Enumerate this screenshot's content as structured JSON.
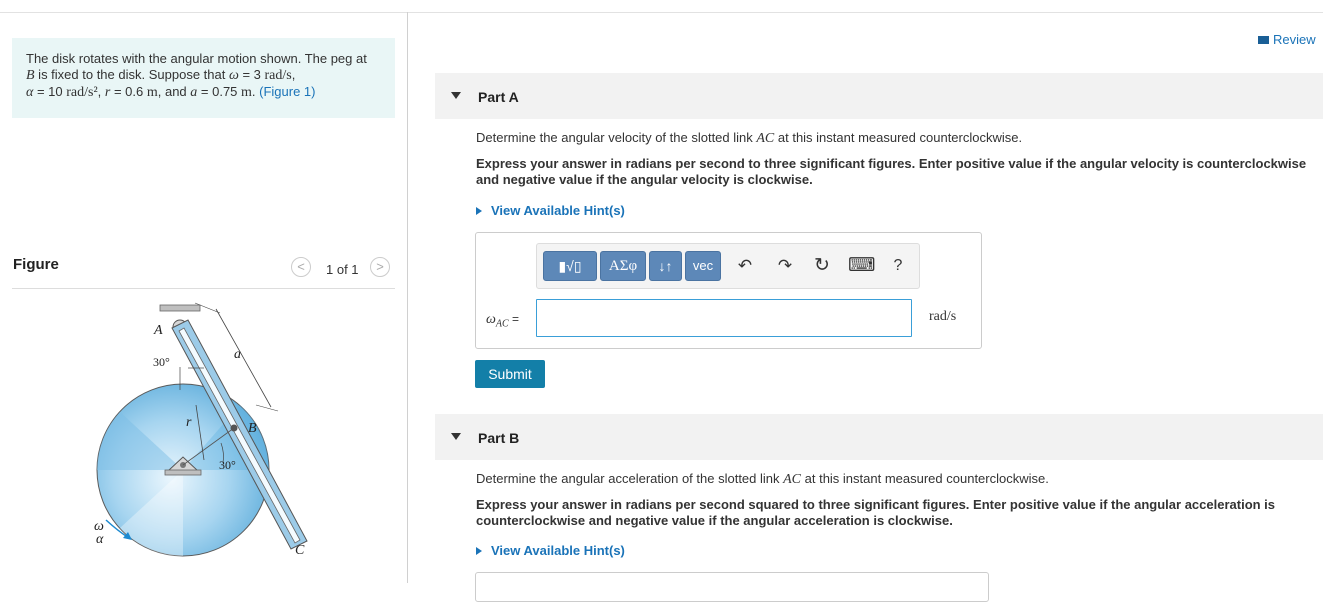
{
  "problem": {
    "line1": "The disk rotates with the angular motion shown. The peg at",
    "line2_var": "B",
    "line2_text": " is fixed to the disk. Suppose that ",
    "omega_sym": "ω",
    "omega_eq": " = 3 ",
    "omega_unit": "rad/s",
    "line2_end": ",",
    "alpha_sym": "α",
    "alpha_eq": " = 10 ",
    "alpha_unit": "rad/s²",
    "sep1": ", ",
    "r_sym": "r",
    "r_eq": " = 0.6 ",
    "r_unit": "m",
    "sep2": ", and ",
    "a_sym": "a",
    "a_eq": " = 0.75 ",
    "a_unit": "m",
    "end": ". ",
    "figure_link": "(Figure 1)"
  },
  "figure": {
    "title": "Figure",
    "pager": "1 of 1",
    "prev": "<",
    "next": ">",
    "labels": {
      "A": "A",
      "B": "B",
      "C": "C",
      "a": "a",
      "r": "r",
      "angle_top": "30°",
      "angle_bottom": "30°",
      "omega": "ω",
      "alpha": "α"
    }
  },
  "review": "Review",
  "partA": {
    "label": "Part A",
    "question_pre": "Determine the angular velocity of the slotted link ",
    "question_var": "AC",
    "question_post": " at this instant measured counterclockwise.",
    "instruction": "Express your answer in radians per second to three significant figures. Enter positive value if the angular velocity is counterclockwise and negative value if the angular velocity is clockwise.",
    "hint": "View Available Hint(s)",
    "toolbar": {
      "templates": "▮√▯",
      "greek": "ΑΣφ",
      "updown": "↓↑",
      "vec": "vec",
      "undo": "↶",
      "redo": "↷",
      "reset": "↻",
      "keyboard": "⌨",
      "help": "?"
    },
    "var_omega": "ω",
    "var_sub": "AC",
    "equals": " =",
    "input_value": "",
    "unit": "rad/s",
    "submit": "Submit"
  },
  "partB": {
    "label": "Part B",
    "question_pre": "Determine the angular acceleration of the slotted link ",
    "question_var": "AC",
    "question_post": " at this instant measured counterclockwise.",
    "instruction": "Express your answer in radians per second squared to three significant figures. Enter positive value if the angular acceleration is counterclockwise and negative value if the angular acceleration is clockwise.",
    "hint": "View Available Hint(s)"
  },
  "colors": {
    "link": "#1a73b8",
    "problem_bg": "#e9f6f6",
    "submit_bg": "#137fa8",
    "toolbar_blue": "#5d88b8",
    "disk_light": "#d5ecf8",
    "disk_dark": "#3f9cd2"
  }
}
